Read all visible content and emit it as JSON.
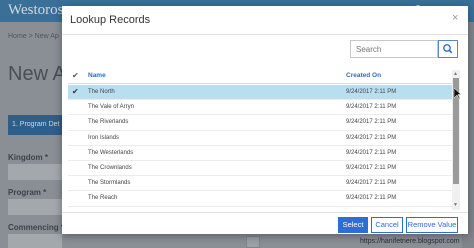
{
  "background": {
    "brand": "Westoros",
    "user": "user",
    "breadcrumb": "Home > New Ap",
    "page_title": "New A",
    "tab": "1. Program Det",
    "labels": [
      "Kingdom *",
      "Program *",
      "Commencing *"
    ],
    "footer": "https://hanifetnere.blogspot.com"
  },
  "modal": {
    "title": "Lookup Records",
    "close": "×",
    "search_placeholder": "Search",
    "columns": {
      "name": "Name",
      "created": "Created On"
    },
    "rows": [
      {
        "name": "The North",
        "created": "9/24/2017 2:11 PM",
        "selected": true
      },
      {
        "name": "The Vale of Arryn",
        "created": "9/24/2017 2:11 PM",
        "selected": false
      },
      {
        "name": "The Riverlands",
        "created": "9/24/2017 2:11 PM",
        "selected": false
      },
      {
        "name": "Iron Islands",
        "created": "9/24/2017 2:11 PM",
        "selected": false
      },
      {
        "name": "The Westerlands",
        "created": "9/24/2017 2:11 PM",
        "selected": false
      },
      {
        "name": "The Crownlands",
        "created": "9/24/2017 2:11 PM",
        "selected": false
      },
      {
        "name": "The Stormlands",
        "created": "9/24/2017 2:11 PM",
        "selected": false
      },
      {
        "name": "The Reach",
        "created": "9/24/2017 2:11 PM",
        "selected": false
      }
    ],
    "buttons": {
      "select": "Select",
      "cancel": "Cancel",
      "remove": "Remove Value"
    }
  },
  "colors": {
    "accent": "#2d6ed6",
    "selected_row": "#b9def0",
    "header": "#3a6f98"
  }
}
